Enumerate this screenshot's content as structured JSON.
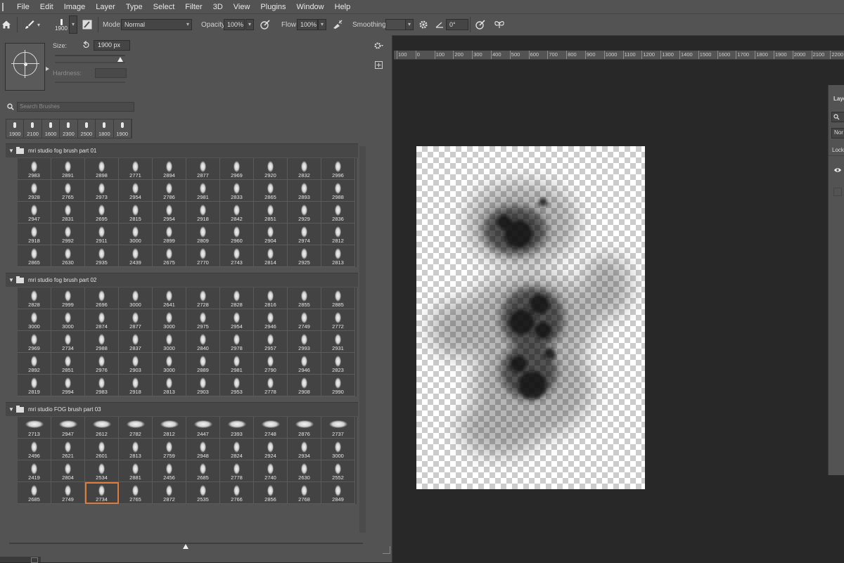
{
  "menu": [
    "File",
    "Edit",
    "Image",
    "Layer",
    "Type",
    "Select",
    "Filter",
    "3D",
    "View",
    "Plugins",
    "Window",
    "Help"
  ],
  "options": {
    "brush_size_label": "1900",
    "mode_label": "Mode:",
    "mode_value": "Normal",
    "opacity_label": "Opacity:",
    "opacity_value": "100%",
    "flow_label": "Flow:",
    "flow_value": "100%",
    "smoothing_label": "Smoothing:",
    "angle_value": "0°"
  },
  "brush_panel": {
    "size_label": "Size:",
    "size_value": "1900 px",
    "hardness_label": "Hardness:",
    "search_placeholder": "Search Brushes",
    "recent": [
      "1900",
      "2100",
      "1600",
      "2300",
      "2500",
      "1800",
      "1900"
    ],
    "groups": [
      {
        "name": "mri studio fog brush part 01",
        "tiles": [
          "2983",
          "2891",
          "2898",
          "2771",
          "2894",
          "2877",
          "2969",
          "2920",
          "2832",
          "2996",
          "2928",
          "2765",
          "2973",
          "2954",
          "2786",
          "2981",
          "2833",
          "2865",
          "2893",
          "2988",
          "2947",
          "2831",
          "2695",
          "2815",
          "2954",
          "2918",
          "2842",
          "2851",
          "2929",
          "2836",
          "2918",
          "2992",
          "2911",
          "3000",
          "2899",
          "2809",
          "2960",
          "2904",
          "2974",
          "2812",
          "2865",
          "2630",
          "2935",
          "2439",
          "2675",
          "2770",
          "2743",
          "2814",
          "2925",
          "2813"
        ]
      },
      {
        "name": "mri studio fog brush part 02",
        "tiles": [
          "2828",
          "2999",
          "2696",
          "3000",
          "2641",
          "2728",
          "2828",
          "2816",
          "2855",
          "2885",
          "3000",
          "3000",
          "2874",
          "2877",
          "3000",
          "2975",
          "2954",
          "2946",
          "2749",
          "2772",
          "2969",
          "2734",
          "2988",
          "2837",
          "3000",
          "2840",
          "2978",
          "2957",
          "2993",
          "2931",
          "2892",
          "2851",
          "2976",
          "2903",
          "3000",
          "2889",
          "2981",
          "2790",
          "2946",
          "2823",
          "2819",
          "2994",
          "2983",
          "2918",
          "2813",
          "2903",
          "2953",
          "2778",
          "2908",
          "2990"
        ]
      },
      {
        "name": "mri studio FOG brush part 03",
        "tiles": [
          "2713",
          "2947",
          "2612",
          "2782",
          "2812",
          "2447",
          "2393",
          "2748",
          "2876",
          "2737",
          "2496",
          "2621",
          "2601",
          "2813",
          "2759",
          "2948",
          "2824",
          "2924",
          "2934",
          "3000",
          "2419",
          "2804",
          "2534",
          "2881",
          "2456",
          "2685",
          "2778",
          "2740",
          "2630",
          "2552",
          "2685",
          "2749",
          "2734",
          "2765",
          "2872",
          "2535",
          "2766",
          "2856",
          "2768",
          "2849"
        ],
        "selected_index": 32
      }
    ]
  },
  "ruler": [
    "100",
    "0",
    "100",
    "200",
    "300",
    "400",
    "500",
    "600",
    "700",
    "800",
    "900",
    "1000",
    "1100",
    "1200",
    "1300",
    "1400",
    "1500",
    "1600",
    "1700",
    "1800",
    "1900",
    "2000",
    "2100",
    "2200"
  ],
  "layers_panel": {
    "title": "Laye",
    "blend_short": "Nor",
    "lock_short": "Lock"
  },
  "colors": {
    "selection_outline": "#e07b3a",
    "panel_bg": "#535353",
    "app_bg": "#282828"
  }
}
